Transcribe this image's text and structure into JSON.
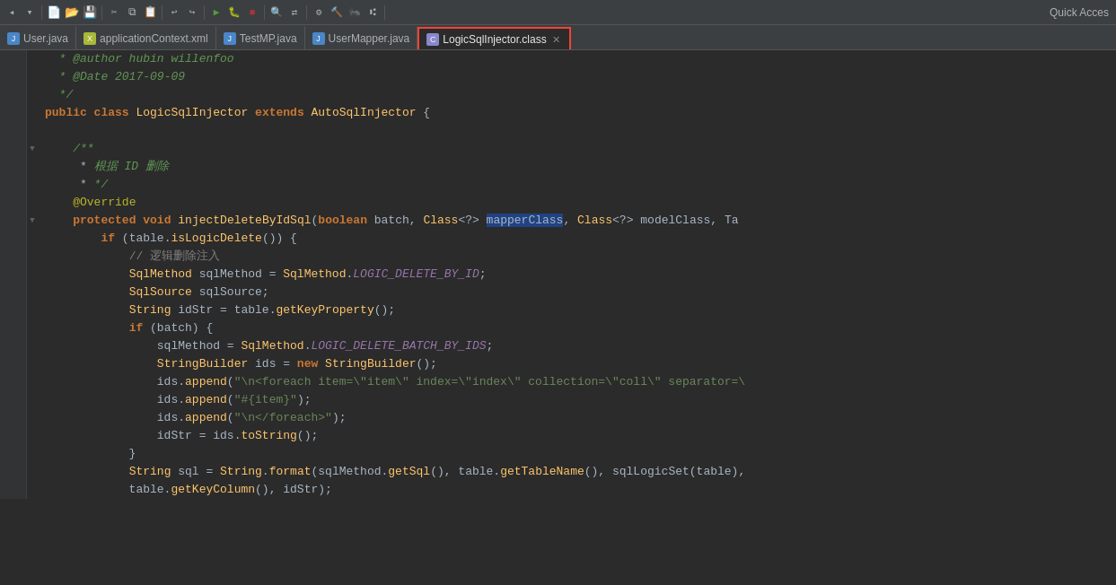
{
  "toolbar": {
    "quick_access_label": "Quick Acces"
  },
  "tabs": [
    {
      "id": "user-java",
      "label": "User.java",
      "type": "java",
      "active": false,
      "closable": false
    },
    {
      "id": "app-context",
      "label": "applicationContext.xml",
      "type": "xml",
      "active": false,
      "closable": false
    },
    {
      "id": "testmp-java",
      "label": "TestMP.java",
      "type": "java",
      "active": false,
      "closable": false
    },
    {
      "id": "usermapper-java",
      "label": "UserMapper.java",
      "type": "java",
      "active": false,
      "closable": false
    },
    {
      "id": "logicsql-class",
      "label": "LogicSqlInjector.class",
      "type": "class",
      "active": true,
      "closable": true
    }
  ],
  "code": {
    "lines": [
      {
        "num": "",
        "content": "  * <span class='cmt'>@author hubin willenfoo</span>"
      },
      {
        "num": "",
        "content": "  * <span class='cmt'>@Date 2017-09-09</span>"
      },
      {
        "num": "",
        "content": "  * <span class='cmt'>*/</span>"
      },
      {
        "num": "",
        "content": "<span class='kw'>public class</span> <span class='cl'>LogicSqlInjector</span> <span class='kw'>extends</span> <span class='cl'>AutoSqlInjector</span> {"
      },
      {
        "num": "",
        "content": ""
      },
      {
        "num": "",
        "content": "    <span class='cmt'>/**</span>"
      },
      {
        "num": "",
        "content": "     * <span class='cmt'>根据 ID 删除</span>"
      },
      {
        "num": "",
        "content": "     * <span class='cmt'>*/</span>"
      },
      {
        "num": "",
        "content": "    <span class='at'>@Override</span>"
      },
      {
        "num": "",
        "content": "    <span class='kw'>protected</span> <span class='kw'>void</span> <span class='fn'>injectDeleteByIdSql</span>(<span class='kw'>boolean</span> <span class='param'>batch</span>, <span class='cl'>Class</span>&lt;?&gt; <span class='hl'>mapperClass</span>, <span class='cl'>Class</span>&lt;?&gt; <span class='param'>modelClass</span>, Ta"
      },
      {
        "num": "",
        "content": "        <span class='kw'>if</span> (table.<span class='fn'>isLogicDelete</span>()) {"
      },
      {
        "num": "",
        "content": "            <span class='cm'>// 逻辑删除注入</span>"
      },
      {
        "num": "",
        "content": "            <span class='cl'>SqlMethod</span> sqlMethod = <span class='cl'>SqlMethod</span>.<span class='static-italic'>LOGIC_DELETE_BY_ID</span>;"
      },
      {
        "num": "",
        "content": "            <span class='cl'>SqlSource</span> sqlSource;"
      },
      {
        "num": "",
        "content": "            <span class='cl'>String</span> idStr = table.<span class='fn'>getKeyProperty</span>();"
      },
      {
        "num": "",
        "content": "            <span class='kw'>if</span> (batch) {"
      },
      {
        "num": "",
        "content": "                sqlMethod = <span class='cl'>SqlMethod</span>.<span class='static-italic'>LOGIC_DELETE_BATCH_BY_IDS</span>;"
      },
      {
        "num": "",
        "content": "                <span class='cl'>StringBuilder</span> ids = <span class='kw'>new</span> <span class='cl'>StringBuilder</span>();"
      },
      {
        "num": "",
        "content": "                ids.<span class='fn'>append</span>(<span class='str'>\"\\n&lt;foreach item=\\\"item\\\" index=\\\"index\\\" collection=\\\"coll\\\" separator=\\</span>"
      },
      {
        "num": "",
        "content": "                ids.<span class='fn'>append</span>(<span class='str'>\"#{item}\"</span>);"
      },
      {
        "num": "",
        "content": "                ids.<span class='fn'>append</span>(<span class='str'>\"\\n&lt;/foreach&gt;\"</span>);"
      },
      {
        "num": "",
        "content": "                idStr = ids.<span class='fn'>toString</span>();"
      },
      {
        "num": "",
        "content": "            }"
      },
      {
        "num": "",
        "content": "            <span class='cl'>String</span> sql = <span class='cl'>String</span>.<span class='fn'>format</span>(sqlMethod.<span class='fn'>getSql</span>(), table.<span class='fn'>getTableName</span>(), sqlLogicSet(table),"
      },
      {
        "num": "",
        "content": "            table.<span class='fn'>getKeyColumn</span>(), idStr);"
      }
    ]
  }
}
